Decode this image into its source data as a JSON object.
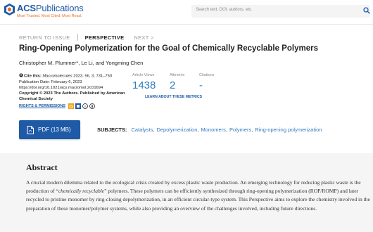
{
  "header": {
    "brand": "ACS",
    "brand_suffix": "Publications",
    "tagline": "Most Trusted. Most Cited. Most Read.",
    "search_placeholder": "Search text, DOI, authors, etc."
  },
  "nav": {
    "return": "RETURN TO ISSUE",
    "current": "PERSPECTIVE",
    "next": "NEXT >"
  },
  "article": {
    "title": "Ring-Opening Polymerization for the Goal of Chemically Recyclable Polymers",
    "authors": "Christopher M. Plummer*, Le Li, and Yongming Chen",
    "cite_label": "Cite this:",
    "cite_journal": "Macromolecules",
    "cite_details": "2023, 56, 3, 731–750",
    "pub_date": "Publication Date: February 6, 2023",
    "doi": "https://doi.org/10.1021/acs.macromol.2c01694",
    "copyright": "Copyright © 2023 The Authors. Published by American Chemical Society",
    "rights": "RIGHTS & PERMISSIONS"
  },
  "metrics": {
    "views_label": "Article Views",
    "views": "1438",
    "altmetric_label": "Altmetric",
    "altmetric": "2",
    "citations_label": "Citations",
    "citations": "-",
    "learn": "LEARN ABOUT THESE METRICS"
  },
  "pdf": {
    "label": "PDF (13 MB)"
  },
  "subjects": {
    "label": "SUBJECTS:",
    "items": [
      "Catalysts",
      "Depolymerization",
      "Monomers",
      "Polymers",
      "Ring-opening polymerization"
    ]
  },
  "abstract": {
    "title": "Abstract",
    "text_before": "A crucial modern dilemma related to the ecological crisis created by excess plastic waste production. An emerging technology for reducing plastic waste is the production of “",
    "text_emph": "chemically recyclable",
    "text_after": "” polymers. These polymers can be efficiently synthesized through ring-opening polymerization (ROP/ROMP) and later recycled to pristine monomer by ring-closing depolymerization, in an efficient circular-type system. This Perspective aims to explore the chemistry involved in the preparation of these monomer/polymer systems, while also providing an overview of the challenges involved, including future directions."
  },
  "colors": {
    "brand_blue": "#1f5aa6",
    "metric_blue": "#2f7bbf",
    "tagline_orange": "#e0702a"
  }
}
